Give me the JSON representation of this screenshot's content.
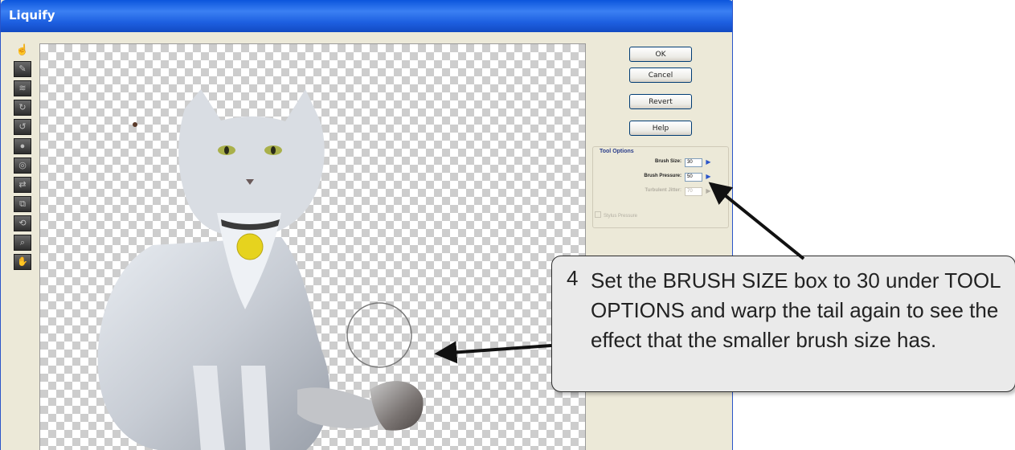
{
  "window": {
    "title": "Liquify"
  },
  "toolbar": {
    "tools": [
      {
        "icon": "warp-hand-icon",
        "glyph": "☝"
      },
      {
        "icon": "warp-tool-icon",
        "glyph": "✎"
      },
      {
        "icon": "turbulence-tool-icon",
        "glyph": "≋"
      },
      {
        "icon": "twirl-clockwise-icon",
        "glyph": "↻"
      },
      {
        "icon": "twirl-counterclockwise-icon",
        "glyph": "↺"
      },
      {
        "icon": "pucker-tool-icon",
        "glyph": "●"
      },
      {
        "icon": "bloat-tool-icon",
        "glyph": "◎"
      },
      {
        "icon": "shift-pixels-icon",
        "glyph": "⇄"
      },
      {
        "icon": "reflection-tool-icon",
        "glyph": "⧉"
      },
      {
        "icon": "reconstruct-tool-icon",
        "glyph": "⟲"
      },
      {
        "icon": "zoom-tool-icon",
        "glyph": "⌕"
      },
      {
        "icon": "hand-tool-icon",
        "glyph": "✋"
      }
    ]
  },
  "buttons": {
    "ok": "OK",
    "cancel": "Cancel",
    "revert": "Revert",
    "help": "Help"
  },
  "tool_options": {
    "title": "Tool Options",
    "brush_size_label": "Brush Size:",
    "brush_size_value": "30",
    "brush_pressure_label": "Brush Pressure:",
    "brush_pressure_value": "50",
    "turbulent_jitter_label": "Turbulent Jitter:",
    "turbulent_jitter_value": "70",
    "stylus_pressure_label": "Stylus Pressure"
  },
  "callout": {
    "step": "4",
    "text": "Set the BRUSH SIZE box to 30 under TOOL OPTIONS and warp the tail again to see the effect that the smaller brush size has."
  },
  "colors": {
    "title_bar": "#1d5fe0",
    "panel_bg": "#ece9d8",
    "tag_yellow": "#e6d31e",
    "arrow": "#111111"
  }
}
